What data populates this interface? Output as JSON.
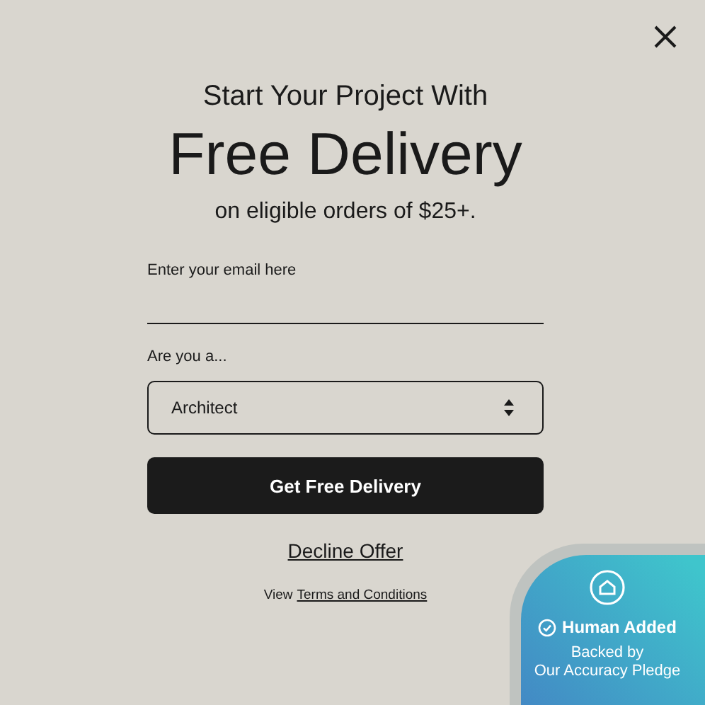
{
  "heading": {
    "pretitle": "Start Your Project With",
    "title": "Free Delivery",
    "subtitle": "on eligible orders of $25+."
  },
  "email": {
    "label": "Enter your email here"
  },
  "role": {
    "label": "Are you a...",
    "value": "Architect"
  },
  "buttons": {
    "submit": "Get Free Delivery",
    "decline": "Decline Offer"
  },
  "terms": {
    "prefix": "View",
    "link": "Terms and Conditions"
  },
  "badge": {
    "title": "Human Added",
    "line1": "Backed by",
    "line2": "Our Accuracy Pledge"
  }
}
